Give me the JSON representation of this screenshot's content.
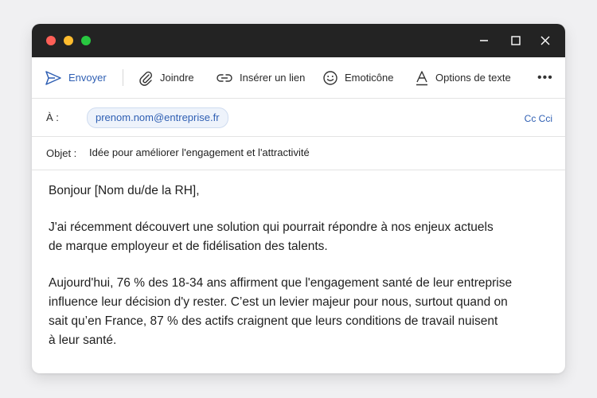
{
  "toolbar": {
    "send_label": "Envoyer",
    "attach_label": "Joindre",
    "link_label": "Insérer un lien",
    "emoji_label": "Emoticône",
    "format_label": "Options de texte",
    "more_label": "•••"
  },
  "to": {
    "label": "À :",
    "recipient": "prenom.nom@entreprise.fr",
    "cc_cci": "Cc Cci"
  },
  "subject": {
    "label": "Objet :",
    "value": "Idée pour améliorer l'engagement et l'attractivité"
  },
  "body": {
    "greeting": "Bonjour [Nom du/de la RH],",
    "paragraph1_line1": "J'ai récemment découvert une solution qui pourrait répondre à nos enjeux actuels",
    "paragraph1_line2": "de marque employeur et de fidélisation des talents.",
    "paragraph2_line1": "Aujourd'hui, 76 % des 18-34 ans affirment que l'engagement santé de leur entreprise",
    "paragraph2_line2": "influence leur décision d'y rester. C’est un levier majeur pour nous, surtout quand on",
    "paragraph2_line3": "sait qu’en France, 87 % des actifs craignent que leurs conditions de travail nuisent",
    "paragraph2_line4": "à leur santé."
  },
  "colors": {
    "accent": "#2f5fb3",
    "titlebar": "#232323",
    "traffic_red": "#fe5f57",
    "traffic_yellow": "#febc2e",
    "traffic_green": "#28c840"
  }
}
